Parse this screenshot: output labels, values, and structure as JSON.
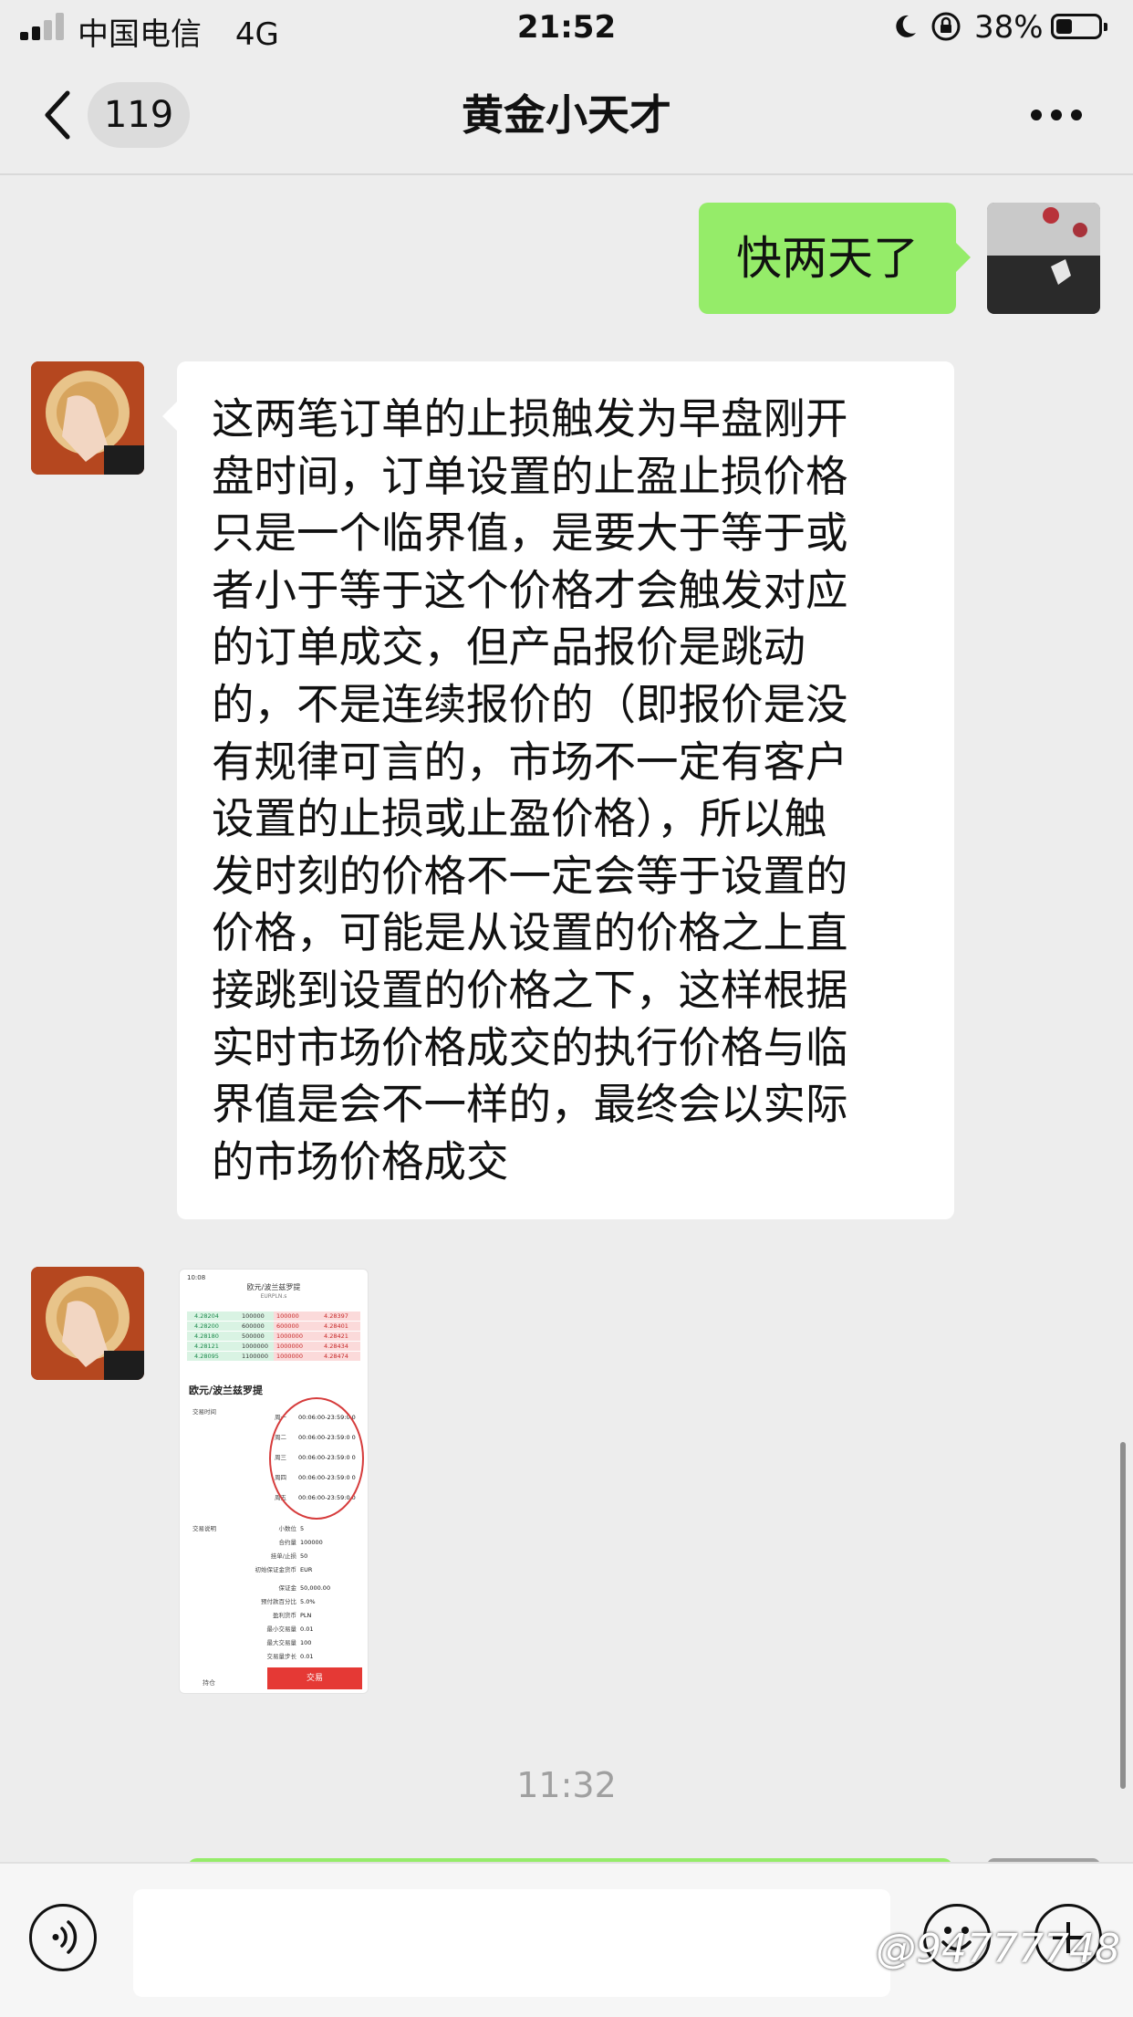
{
  "status_bar": {
    "carrier": "中国电信",
    "network": "4G",
    "time": "21:52",
    "battery_percent": "38%",
    "battery_level": 0.38
  },
  "nav": {
    "back_icon": "chevron-left-icon",
    "unread_count": "119",
    "title": "黄金小天才",
    "more_icon": "more-dots-icon"
  },
  "messages": {
    "outgoing_1": "快两天了",
    "incoming_1": "这两笔订单的止损触发为早盘刚开\n盘时间，订单设置的止盈止损价格\n只是一个临界值，是要大于等于或\n者小于等于这个价格才会触发对应\n的订单成交，但产品报价是跳动\n的，不是连续报价的（即报价是没\n有规律可言的，市场不一定有客户\n设置的止损或止盈价格），所以触\n发时刻的价格不一定会等于设置的\n价格，可能是从设置的价格之上直\n接跳到设置的价格之下，这样根据\n实时市场价格成交的执行价格与临\n界值是会不一样的，最终会以实际\n的市场价格成交",
    "time_separator": "11:32"
  },
  "screenshot": {
    "status_time": "10:08",
    "title": "欧元/波兰兹罗提",
    "symbol": "EURPLN.s",
    "quotes": [
      {
        "bid": "4.28204",
        "bvol": "100000",
        "avol": "100000",
        "ask": "4.28397"
      },
      {
        "bid": "4.28200",
        "bvol": "600000",
        "avol": "600000",
        "ask": "4.28401"
      },
      {
        "bid": "4.28180",
        "bvol": "500000",
        "avol": "1000000",
        "ask": "4.28421"
      },
      {
        "bid": "4.28121",
        "bvol": "1000000",
        "avol": "1000000",
        "ask": "4.28434"
      },
      {
        "bid": "4.28095",
        "bvol": "1100000",
        "avol": "1000000",
        "ask": "4.28474"
      }
    ],
    "section_title": "欧元/波兰兹罗提",
    "trading_time_label": "交易时间",
    "trading_days": [
      {
        "day": "周一",
        "hours": "00:06:00-23:59:0 0"
      },
      {
        "day": "周二",
        "hours": "00:06:00-23:59:0 0"
      },
      {
        "day": "周三",
        "hours": "00:06:00-23:59:0 0"
      },
      {
        "day": "周四",
        "hours": "00:06:00-23:59:0 0"
      },
      {
        "day": "周五",
        "hours": "00:06:00-23:59:0 0"
      }
    ],
    "spec_label": "交易说明",
    "specs": [
      {
        "k": "小数位",
        "v": "5"
      },
      {
        "k": "合约量",
        "v": "100000"
      },
      {
        "k": "挂单/止损",
        "v": "50"
      },
      {
        "k": "初始保证金货币",
        "v": "EUR"
      },
      {
        "k": "保证金",
        "v": "50,000.00"
      },
      {
        "k": "预付款百分比",
        "v": "5.0%"
      },
      {
        "k": "盈利货币",
        "v": "PLN"
      },
      {
        "k": "最小交易量",
        "v": "0.01"
      },
      {
        "k": "最大交易量",
        "v": "100"
      },
      {
        "k": "交易量步长",
        "v": "0.01"
      }
    ],
    "tab_holdings": "持仓",
    "tab_trade": "交易"
  },
  "input_bar": {
    "voice_icon": "voice-icon",
    "emoji_icon": "emoji-icon",
    "plus_icon": "plus-icon",
    "placeholder": ""
  },
  "watermark": "@94777748",
  "colors": {
    "outgoing_bubble": "#95ec69",
    "incoming_bubble": "#ffffff",
    "background": "#ededed",
    "trade_button": "#e53935"
  }
}
